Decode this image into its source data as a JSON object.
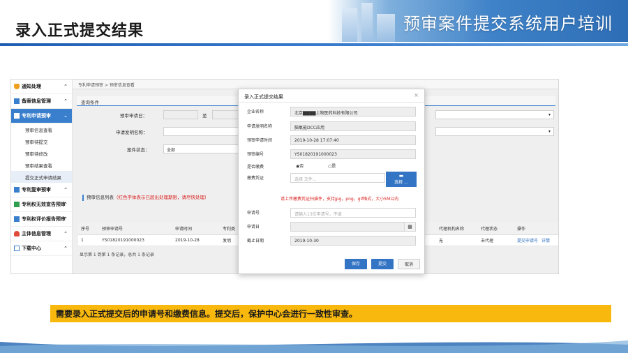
{
  "slide": {
    "title": "录入正式提交结果",
    "banner_text": "预审案件提交系统用户培训",
    "caption": "需要录入正式提交后的申请号和缴费信息。提交后，保护中心会进行一致性审查。"
  },
  "sidebar": {
    "items": [
      {
        "label": "通知处理",
        "icon": "bell-icon",
        "arrow": "⌃"
      },
      {
        "label": "备案信息管理",
        "icon": "folder-icon",
        "arrow": "⌃"
      },
      {
        "label": "专利申请预审",
        "icon": "folder-icon",
        "arrow": "⌄"
      },
      {
        "label": "专利复审预审",
        "icon": "folder-icon",
        "arrow": "⌃"
      },
      {
        "label": "专利权无效宣告预审",
        "icon": "folder-icon",
        "arrow": "⌃"
      },
      {
        "label": "专利权评价报告预审",
        "icon": "folder-icon",
        "arrow": "⌃"
      },
      {
        "label": "主体信息管理",
        "icon": "user-icon",
        "arrow": "⌃"
      },
      {
        "label": "下载中心",
        "icon": "download-icon",
        "arrow": "⌃"
      }
    ],
    "subitems": [
      "预审信息查看",
      "预审待提交",
      "预审待修改",
      "预审结果查看",
      "提交正式申请结果"
    ]
  },
  "main": {
    "breadcrumb": "专利申请预审 > 预审信息查看",
    "panel_title": "查询条件",
    "query": {
      "date_label": "预审申请日：",
      "invention_label": "申请发明名称：",
      "status_label": "案件状态：",
      "status_value": "全部",
      "date_sep": "至"
    },
    "list_title": "预审信息列表",
    "list_warning": "（红色字体表示已超出处理期限，请尽快处理）",
    "table": {
      "headers": [
        "序号",
        "预审申请号",
        "申请时间",
        "专利类",
        "代理机构名称",
        "代理状态",
        "操作"
      ],
      "rows": [
        {
          "no": "1",
          "app_no": "YS01820191000023",
          "time": "2019-10-28",
          "type": "发明",
          "agency": "无",
          "agent_status": "未代理",
          "action1": "提交申请号",
          "action2": "详情"
        }
      ]
    },
    "footer": "显示第 1 到第 1 条记录，总共 1 条记录"
  },
  "modal": {
    "title": "录入正式提交结果",
    "close": "×",
    "fields": {
      "company_label": "企业名称",
      "company_value": "北京▇▇▇▇上物医药科技有限公司",
      "invention_label": "申请发明名称",
      "invention_value": "脑氧能DCC应用",
      "time_label": "预审申请时间",
      "time_value": "2019-10-28 17:07:40",
      "prenum_label": "预审编号",
      "prenum_value": "YS01820191000023",
      "fee_label": "是否缴费",
      "fee_no": "否",
      "fee_yes": "是",
      "voucher_label": "缴费凭证",
      "voucher_placeholder": "选择 文件...",
      "upload_btn": "选择 ...",
      "upload_note": "请上传缴费凭证扫描件，支持jpg，png，gif格式，大小5M以内",
      "appno_label": "申请号",
      "appno_placeholder": "请输入13位申请号，不填",
      "appdate_label": "申请日",
      "deadline_label": "截止日期",
      "deadline_value": "2019-10-30"
    },
    "buttons": {
      "save": "保存",
      "submit": "提交",
      "cancel": "取消"
    }
  },
  "colors": {
    "accent": "#3374c4",
    "caption_bg": "#f8b80e",
    "warning": "#d9231f"
  }
}
